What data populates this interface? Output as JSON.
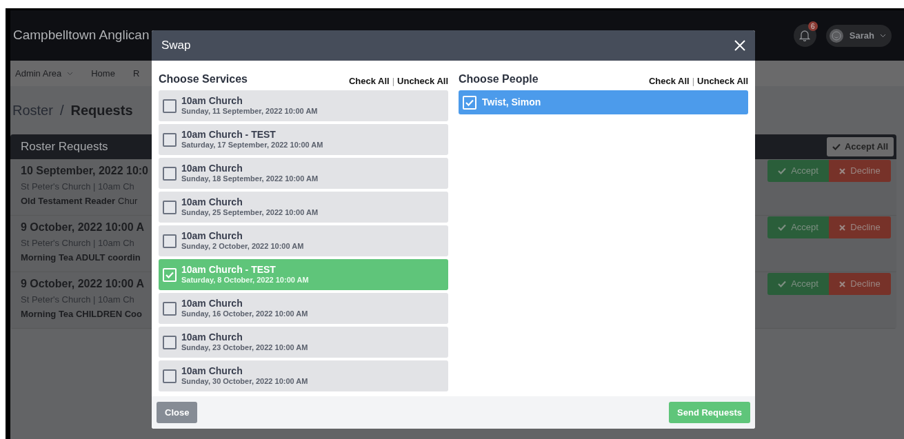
{
  "app": {
    "title": "Campbelltown Anglican",
    "notifications": "6",
    "user": "Sarah"
  },
  "nav": [
    {
      "label": "Admin Area",
      "has_menu": true
    },
    {
      "label": "Home",
      "has_menu": false
    },
    {
      "label": "R",
      "has_menu": false
    }
  ],
  "breadcrumb": {
    "parent": "Roster",
    "separator": "/",
    "current": "Requests"
  },
  "requests_card": {
    "title": "Roster Requests",
    "accept_all": "Accept All",
    "rows": [
      {
        "date": "10 September, 2022 10:0",
        "location": "St Peter's Church | 10am Ch",
        "role": "Old Testament Reader",
        "extra": "Chur",
        "accept": "Accept",
        "decline": "Decline"
      },
      {
        "date": "9 October, 2022 10:00 A",
        "location": "St Peter's Church | 10am Ch",
        "role": "Morning Tea ADULT coordin",
        "accept": "Accept",
        "decline": "Decline"
      },
      {
        "date": "9 October, 2022 10:00 A",
        "location": "St Peter's Church | 10am Ch",
        "role": "Morning Tea CHILDREN Coo",
        "accept": "Accept",
        "decline": "Decline"
      }
    ]
  },
  "dialog": {
    "title": "Swap",
    "close_button": "Close",
    "send_button": "Send Requests",
    "services": {
      "heading": "Choose Services",
      "check_all": "Check All",
      "divider": "|",
      "uncheck_all": "Uncheck All",
      "items": [
        {
          "name": "10am Church",
          "when": "Sunday, 11 September, 2022 10:00 AM",
          "selected": false
        },
        {
          "name": "10am Church - TEST",
          "when": "Saturday, 17 September, 2022 10:00 AM",
          "selected": false
        },
        {
          "name": "10am Church",
          "when": "Sunday, 18 September, 2022 10:00 AM",
          "selected": false
        },
        {
          "name": "10am Church",
          "when": "Sunday, 25 September, 2022 10:00 AM",
          "selected": false
        },
        {
          "name": "10am Church",
          "when": "Sunday, 2 October, 2022 10:00 AM",
          "selected": false
        },
        {
          "name": "10am Church - TEST",
          "when": "Saturday, 8 October, 2022 10:00 AM",
          "selected": true
        },
        {
          "name": "10am Church",
          "when": "Sunday, 16 October, 2022 10:00 AM",
          "selected": false
        },
        {
          "name": "10am Church",
          "when": "Sunday, 23 October, 2022 10:00 AM",
          "selected": false
        },
        {
          "name": "10am Church",
          "when": "Sunday, 30 October, 2022 10:00 AM",
          "selected": false
        }
      ]
    },
    "people": {
      "heading": "Choose People",
      "check_all": "Check All",
      "divider": "|",
      "uncheck_all": "Uncheck All",
      "items": [
        {
          "name": "Twist, Simon",
          "selected": true
        }
      ]
    }
  }
}
